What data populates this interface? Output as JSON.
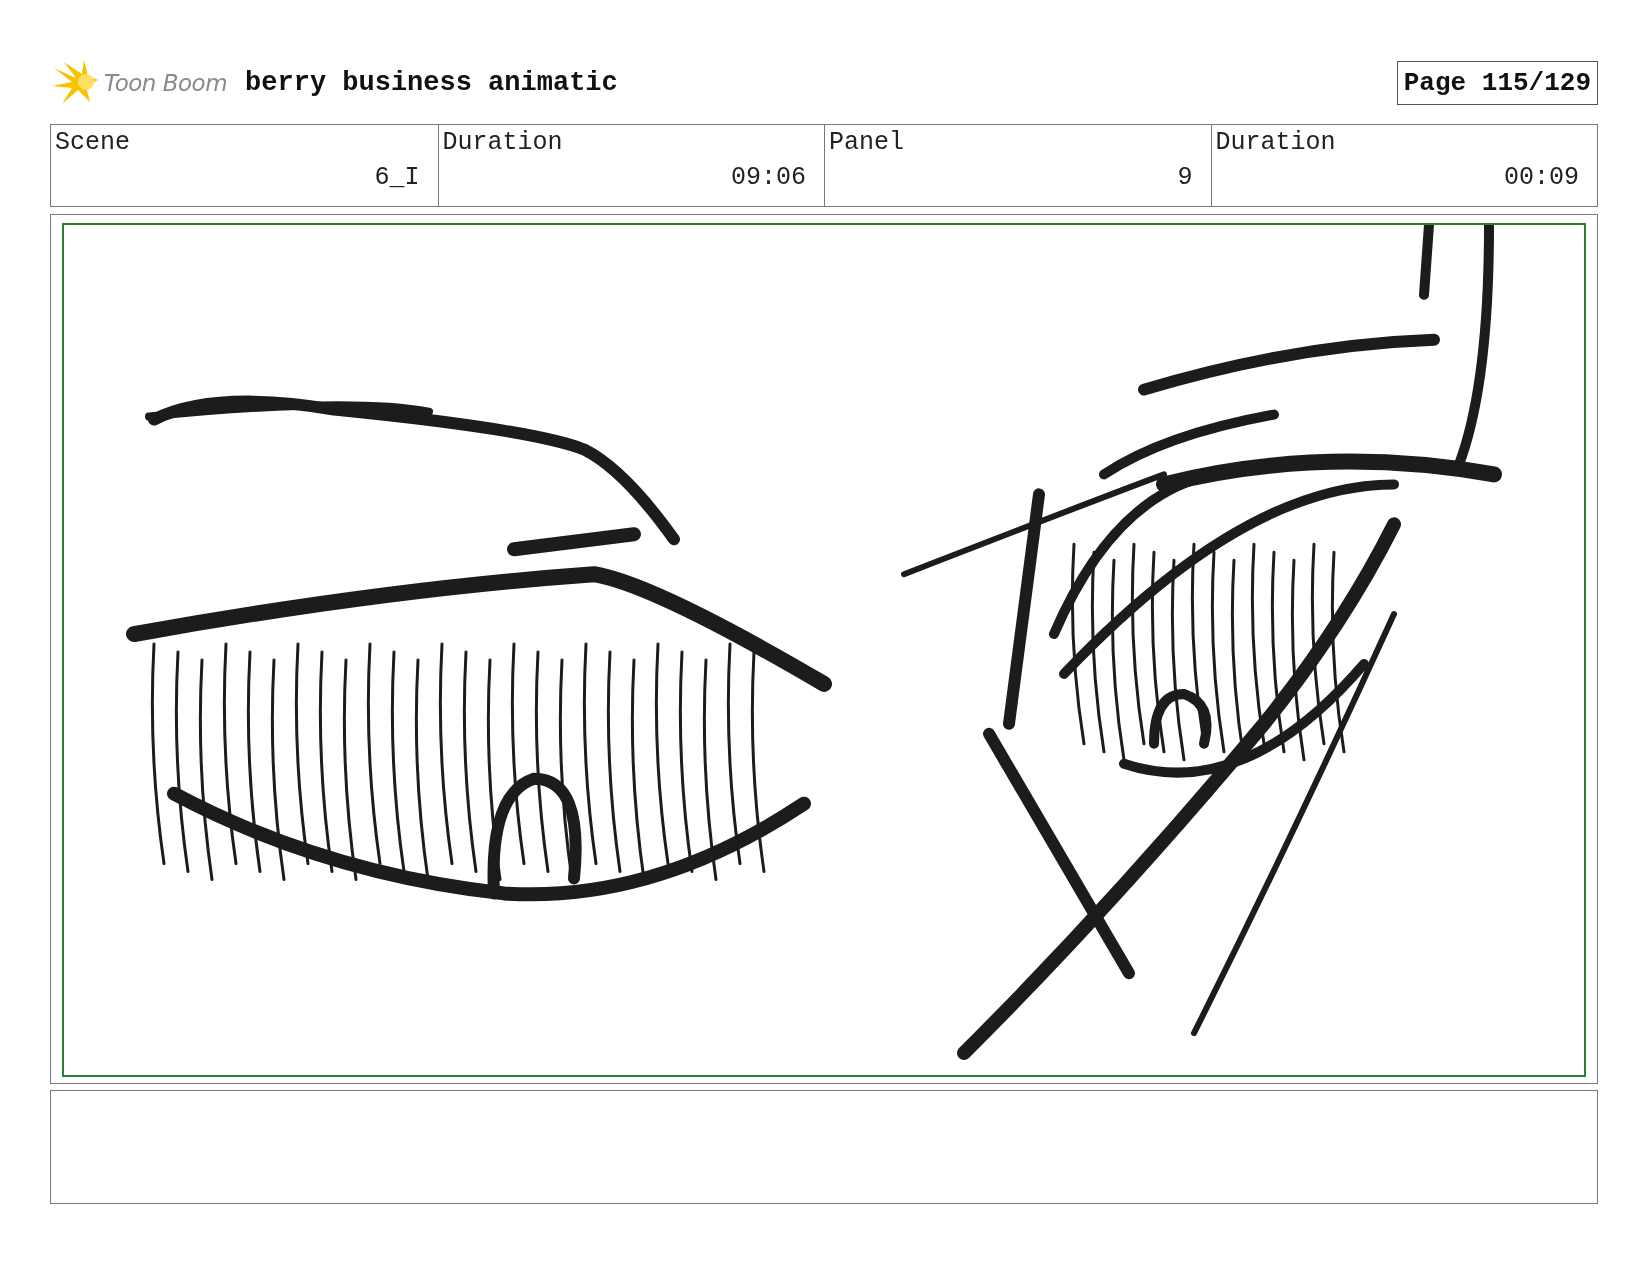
{
  "header": {
    "logo_text": "Toon Boom",
    "title": "berry business animatic",
    "page": "Page 115/129"
  },
  "fields": [
    {
      "label": "Scene",
      "value": "6_I"
    },
    {
      "label": "Duration",
      "value": "09:06"
    },
    {
      "label": "Panel",
      "value": "9"
    },
    {
      "label": "Duration",
      "value": "00:09"
    }
  ]
}
